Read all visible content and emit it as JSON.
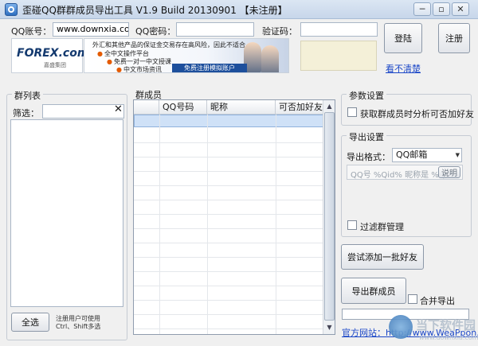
{
  "window": {
    "title": "歪碰QQ群群成员导出工具 V1.9 Build 20130901 【未注册】",
    "minimize_icon": "minimize-icon",
    "restore_icon": "restore-icon",
    "close_icon": "close-icon"
  },
  "login": {
    "qq_label": "QQ账号：",
    "qq_value": "www.downxia.com",
    "password_label": "QQ密码：",
    "password_value": "",
    "captcha_label": "验证码：",
    "captcha_value": "",
    "login_button": "登陆",
    "register_button": "注册",
    "cant_see_link": "看不清楚"
  },
  "ad": {
    "logo": "FOREX.com",
    "logo_sub": "嘉盛集团",
    "headline": "外汇和其他产品的保证金交易存在高风险，因此不适合",
    "bullets": [
      "全中文操作平台",
      "免费一对一中文授课",
      "中文市场资讯"
    ],
    "cta": "免费注册模拟账户"
  },
  "group_list": {
    "title": "群列表",
    "filter_label": "筛选：",
    "filter_value": "",
    "clear_icon": "clear-icon",
    "select_all_button": "全选",
    "hint_line1": "注册用户可使用",
    "hint_line2": "Ctrl、Shift多选"
  },
  "members": {
    "title": "群成员",
    "columns": [
      "QQ号码",
      "昵称",
      "可否加好友"
    ],
    "rows": []
  },
  "param_settings": {
    "title": "参数设置",
    "analyze_friend_label": "获取群成员时分析可否加好友",
    "analyze_friend_checked": false
  },
  "export_settings": {
    "title": "导出设置",
    "format_label": "导出格式：",
    "format_value": "QQ邮箱",
    "template_value": "QQ号 %Qid% 昵称是 %Q",
    "explain_button": "说明",
    "filter_admin_label": "过滤群管理",
    "filter_admin_checked": false
  },
  "actions": {
    "add_friends_button": "尝试添加一批好友",
    "export_button": "导出群成员",
    "merge_export_label": "合并导出",
    "merge_export_checked": false,
    "progress": 0
  },
  "footer": {
    "site_label": "官方网站：",
    "site_url": "http://www.WeaPpon.Com"
  },
  "watermark": {
    "text": "当下软件园",
    "sub": "www.downxia.com"
  }
}
